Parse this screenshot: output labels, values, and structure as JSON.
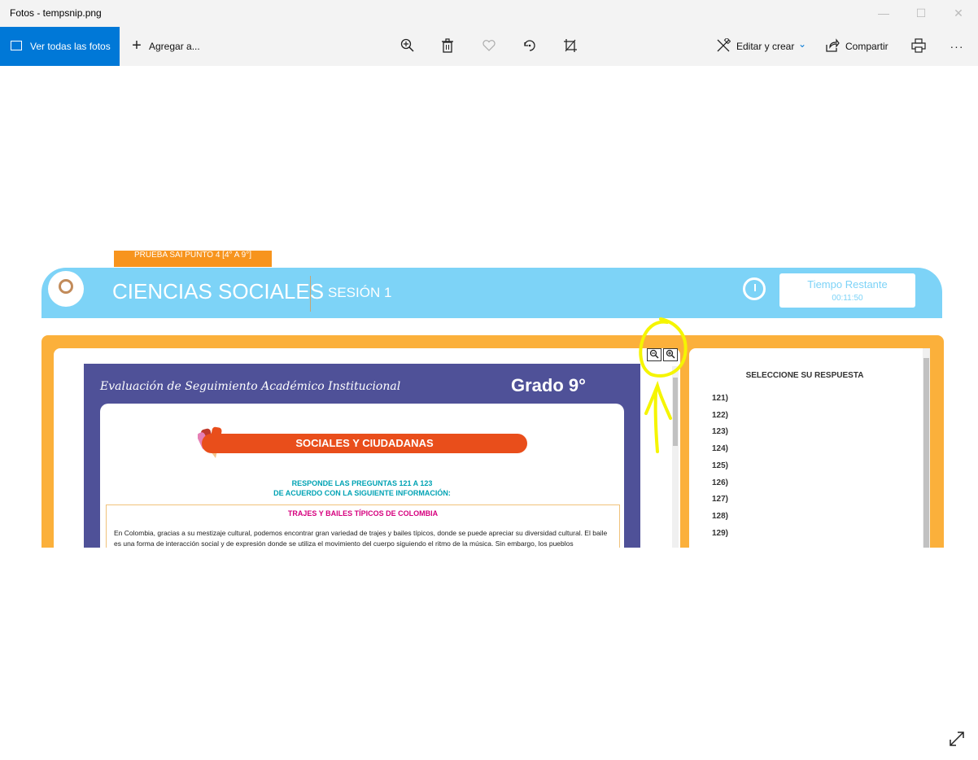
{
  "window": {
    "title": "Fotos - tempsnip.png"
  },
  "toolbar": {
    "view_all_label": "Ver todas las fotos",
    "add_label": "Agregar a...",
    "edit_label": "Editar y crear",
    "share_label": "Compartir",
    "more_label": "···"
  },
  "exam": {
    "tag": "PRUEBA SAI PUNTO 4 [4° A 9°]",
    "subject": "CIENCIAS SOCIALES",
    "session": "SESIÓN 1",
    "timer_label": "Tiempo Restante",
    "timer_value": "00:11:50"
  },
  "document": {
    "header_title": "Evaluación de Seguimiento Académico Institucional",
    "grade": "Grado 9°",
    "banner": "SOCIALES Y CIUDADANAS",
    "instruction_line1": "RESPONDE LAS PREGUNTAS 121 A 123",
    "instruction_line2": "DE ACUERDO CON LA SIGUIENTE INFORMACIÓN:",
    "passage_title": "TRAJES Y BAILES TÍPICOS DE COLOMBIA",
    "passage_text": "En Colombia, gracias a su mestizaje cultural, podemos encontrar gran variedad de trajes y bailes típicos, donde se puede apreciar su diversidad cultural. El baile es una forma de interacción social y de expresión donde se utiliza el movimiento del cuerpo siguiendo el ritmo de la música. Sin embargo, los pueblos"
  },
  "answers": {
    "title": "SELECCIONE SU RESPUESTA",
    "items": [
      "121)",
      "122)",
      "123)",
      "124)",
      "125)",
      "126)",
      "127)",
      "128)",
      "129)"
    ]
  },
  "colors": {
    "accent": "#0078d7",
    "header_blue": "#7dd3f7",
    "frame_orange": "#fbb03b",
    "doc_purple": "#4f5198",
    "banner_red": "#e94e1b",
    "annotation_yellow": "#f5f500"
  },
  "icons": [
    "picture-icon",
    "plus-icon",
    "zoom-in-icon",
    "trash-icon",
    "heart-icon",
    "rotate-icon",
    "crop-icon",
    "edit-create-icon",
    "chevron-down-icon",
    "share-icon",
    "print-icon",
    "expand-icon",
    "alarm-clock-icon",
    "zoom-out-icon"
  ]
}
